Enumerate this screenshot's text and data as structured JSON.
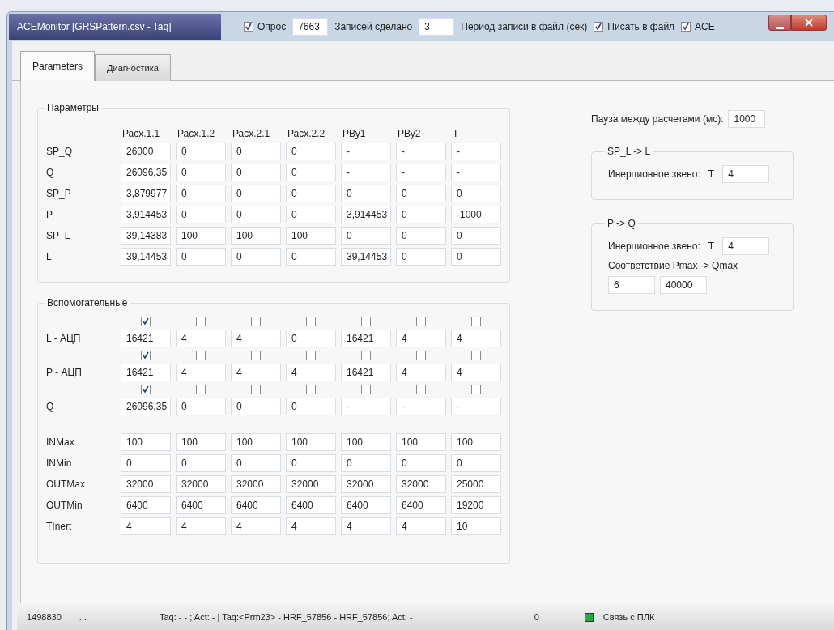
{
  "window": {
    "title": "ACEMonitor [GRSPattern.csv - Taq]"
  },
  "toolbar": [
    {
      "kind": "checkbox",
      "label": "Опрос",
      "checked": true
    },
    {
      "kind": "field",
      "value": "7663"
    },
    {
      "kind": "label",
      "text": "Записей сделано"
    },
    {
      "kind": "field",
      "value": "3"
    },
    {
      "kind": "label",
      "text": "Период записи в файл (сек)"
    },
    {
      "kind": "checkbox",
      "label": "Писать в файл",
      "checked": true
    },
    {
      "kind": "checkbox",
      "label": "ACE",
      "checked": true
    }
  ],
  "tabs": [
    {
      "label": "Parameters",
      "selected": true
    },
    {
      "label": "Диагностика",
      "selected": false
    }
  ],
  "params": {
    "title": "Параметры",
    "columns": [
      "Расх.1.1",
      "Расх.1.2",
      "Расх.2.1",
      "Расх.2.2",
      "PВу1",
      "PВу2",
      "T"
    ],
    "rows": [
      {
        "label": "SP_Q",
        "cells": [
          "26000",
          "0",
          "0",
          "0",
          "-",
          "-",
          "-"
        ]
      },
      {
        "label": "Q",
        "cells": [
          "26096,35",
          "0",
          "0",
          "0",
          "-",
          "-",
          "-"
        ]
      },
      {
        "label": "SP_P",
        "cells": [
          "3,879977",
          "0",
          "0",
          "0",
          "0",
          "0",
          "0"
        ]
      },
      {
        "label": "P",
        "cells": [
          "3,914453",
          "0",
          "0",
          "0",
          "3,914453",
          "0",
          "-1000"
        ]
      },
      {
        "label": "SP_L",
        "cells": [
          "39,14383",
          "100",
          "100",
          "100",
          "0",
          "0",
          "0"
        ]
      },
      {
        "label": "L",
        "cells": [
          "39,14453",
          "0",
          "0",
          "0",
          "39,14453",
          "0",
          "0"
        ]
      }
    ]
  },
  "aux": {
    "title": "Вспомогательные",
    "rows": [
      {
        "label": "L - АЦП",
        "checks": [
          true,
          false,
          false,
          false,
          false,
          false,
          false
        ],
        "cells": [
          "16421",
          "4",
          "4",
          "0",
          "16421",
          "4",
          "4"
        ]
      },
      {
        "label": "P - АЦП",
        "checks": [
          true,
          false,
          false,
          false,
          false,
          false,
          false
        ],
        "cells": [
          "16421",
          "4",
          "4",
          "4",
          "16421",
          "4",
          "4"
        ]
      },
      {
        "label": "Q",
        "checks": [
          true,
          false,
          false,
          false,
          false,
          false,
          false
        ],
        "cells": [
          "26096,35",
          "0",
          "0",
          "0",
          "-",
          "-",
          "-"
        ]
      },
      {
        "label": "INMax",
        "cells": [
          "100",
          "100",
          "100",
          "100",
          "100",
          "100",
          "100"
        ]
      },
      {
        "label": "INMin",
        "cells": [
          "0",
          "0",
          "0",
          "0",
          "0",
          "0",
          "0"
        ]
      },
      {
        "label": "OUTMax",
        "cells": [
          "32000",
          "32000",
          "32000",
          "32000",
          "32000",
          "32000",
          "25000"
        ]
      },
      {
        "label": "OUTMin",
        "cells": [
          "6400",
          "6400",
          "6400",
          "6400",
          "6400",
          "6400",
          "19200"
        ]
      },
      {
        "label": "TInert",
        "cells": [
          "4",
          "4",
          "4",
          "4",
          "4",
          "4",
          "10"
        ]
      }
    ]
  },
  "pause": {
    "label": "Пауза между расчетами (мс):",
    "value": "1000"
  },
  "sp_l_group": {
    "title": "SP_L -> L",
    "label": "Инерционное звено:",
    "t_label": "T",
    "value": "4"
  },
  "p_q_group": {
    "title": "P -> Q",
    "label": "Инерционное звено:",
    "t_label": "T",
    "value": "4",
    "map_label": "Соответствие Pmax -> Qmax",
    "pmax": "6",
    "qmax": "40000"
  },
  "status_bar": {
    "counter": "1498830",
    "dots": "...",
    "message": "Taq: -  - ; Act: -  | Taq:<Prm23> - HRF_57856 - HRF_57856; Act: -",
    "count": "0",
    "connection": {
      "label": "Связь с ПЛК",
      "color": "#22aa44"
    }
  }
}
